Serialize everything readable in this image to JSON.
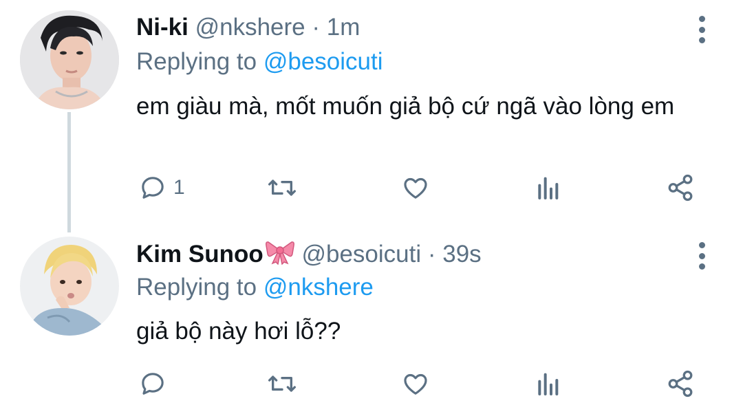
{
  "colors": {
    "accent": "#1d9bf0",
    "secondary": "#5b7083",
    "text": "#0f1419"
  },
  "tweets": [
    {
      "name": "Ni-ki",
      "handle": "@nkshere",
      "separator": "·",
      "time": "1m",
      "replying_prefix": "Replying to ",
      "replying_to": "@besoicuti",
      "text": "em giàu mà, mốt muốn giả bộ cứ ngã vào lòng em",
      "reply_count": "1"
    },
    {
      "name": "Kim Sunoo",
      "name_emoji": "ribbon-emoji",
      "handle": "@besoicuti",
      "separator": "·",
      "time": "39s",
      "replying_prefix": "Replying to ",
      "replying_to": "@nkshere",
      "text": "giả bộ này hơi lỗ??",
      "reply_count": ""
    }
  ],
  "icons": [
    "reply-icon",
    "retweet-icon",
    "like-icon",
    "analytics-icon",
    "share-icon",
    "more-options-icon"
  ]
}
